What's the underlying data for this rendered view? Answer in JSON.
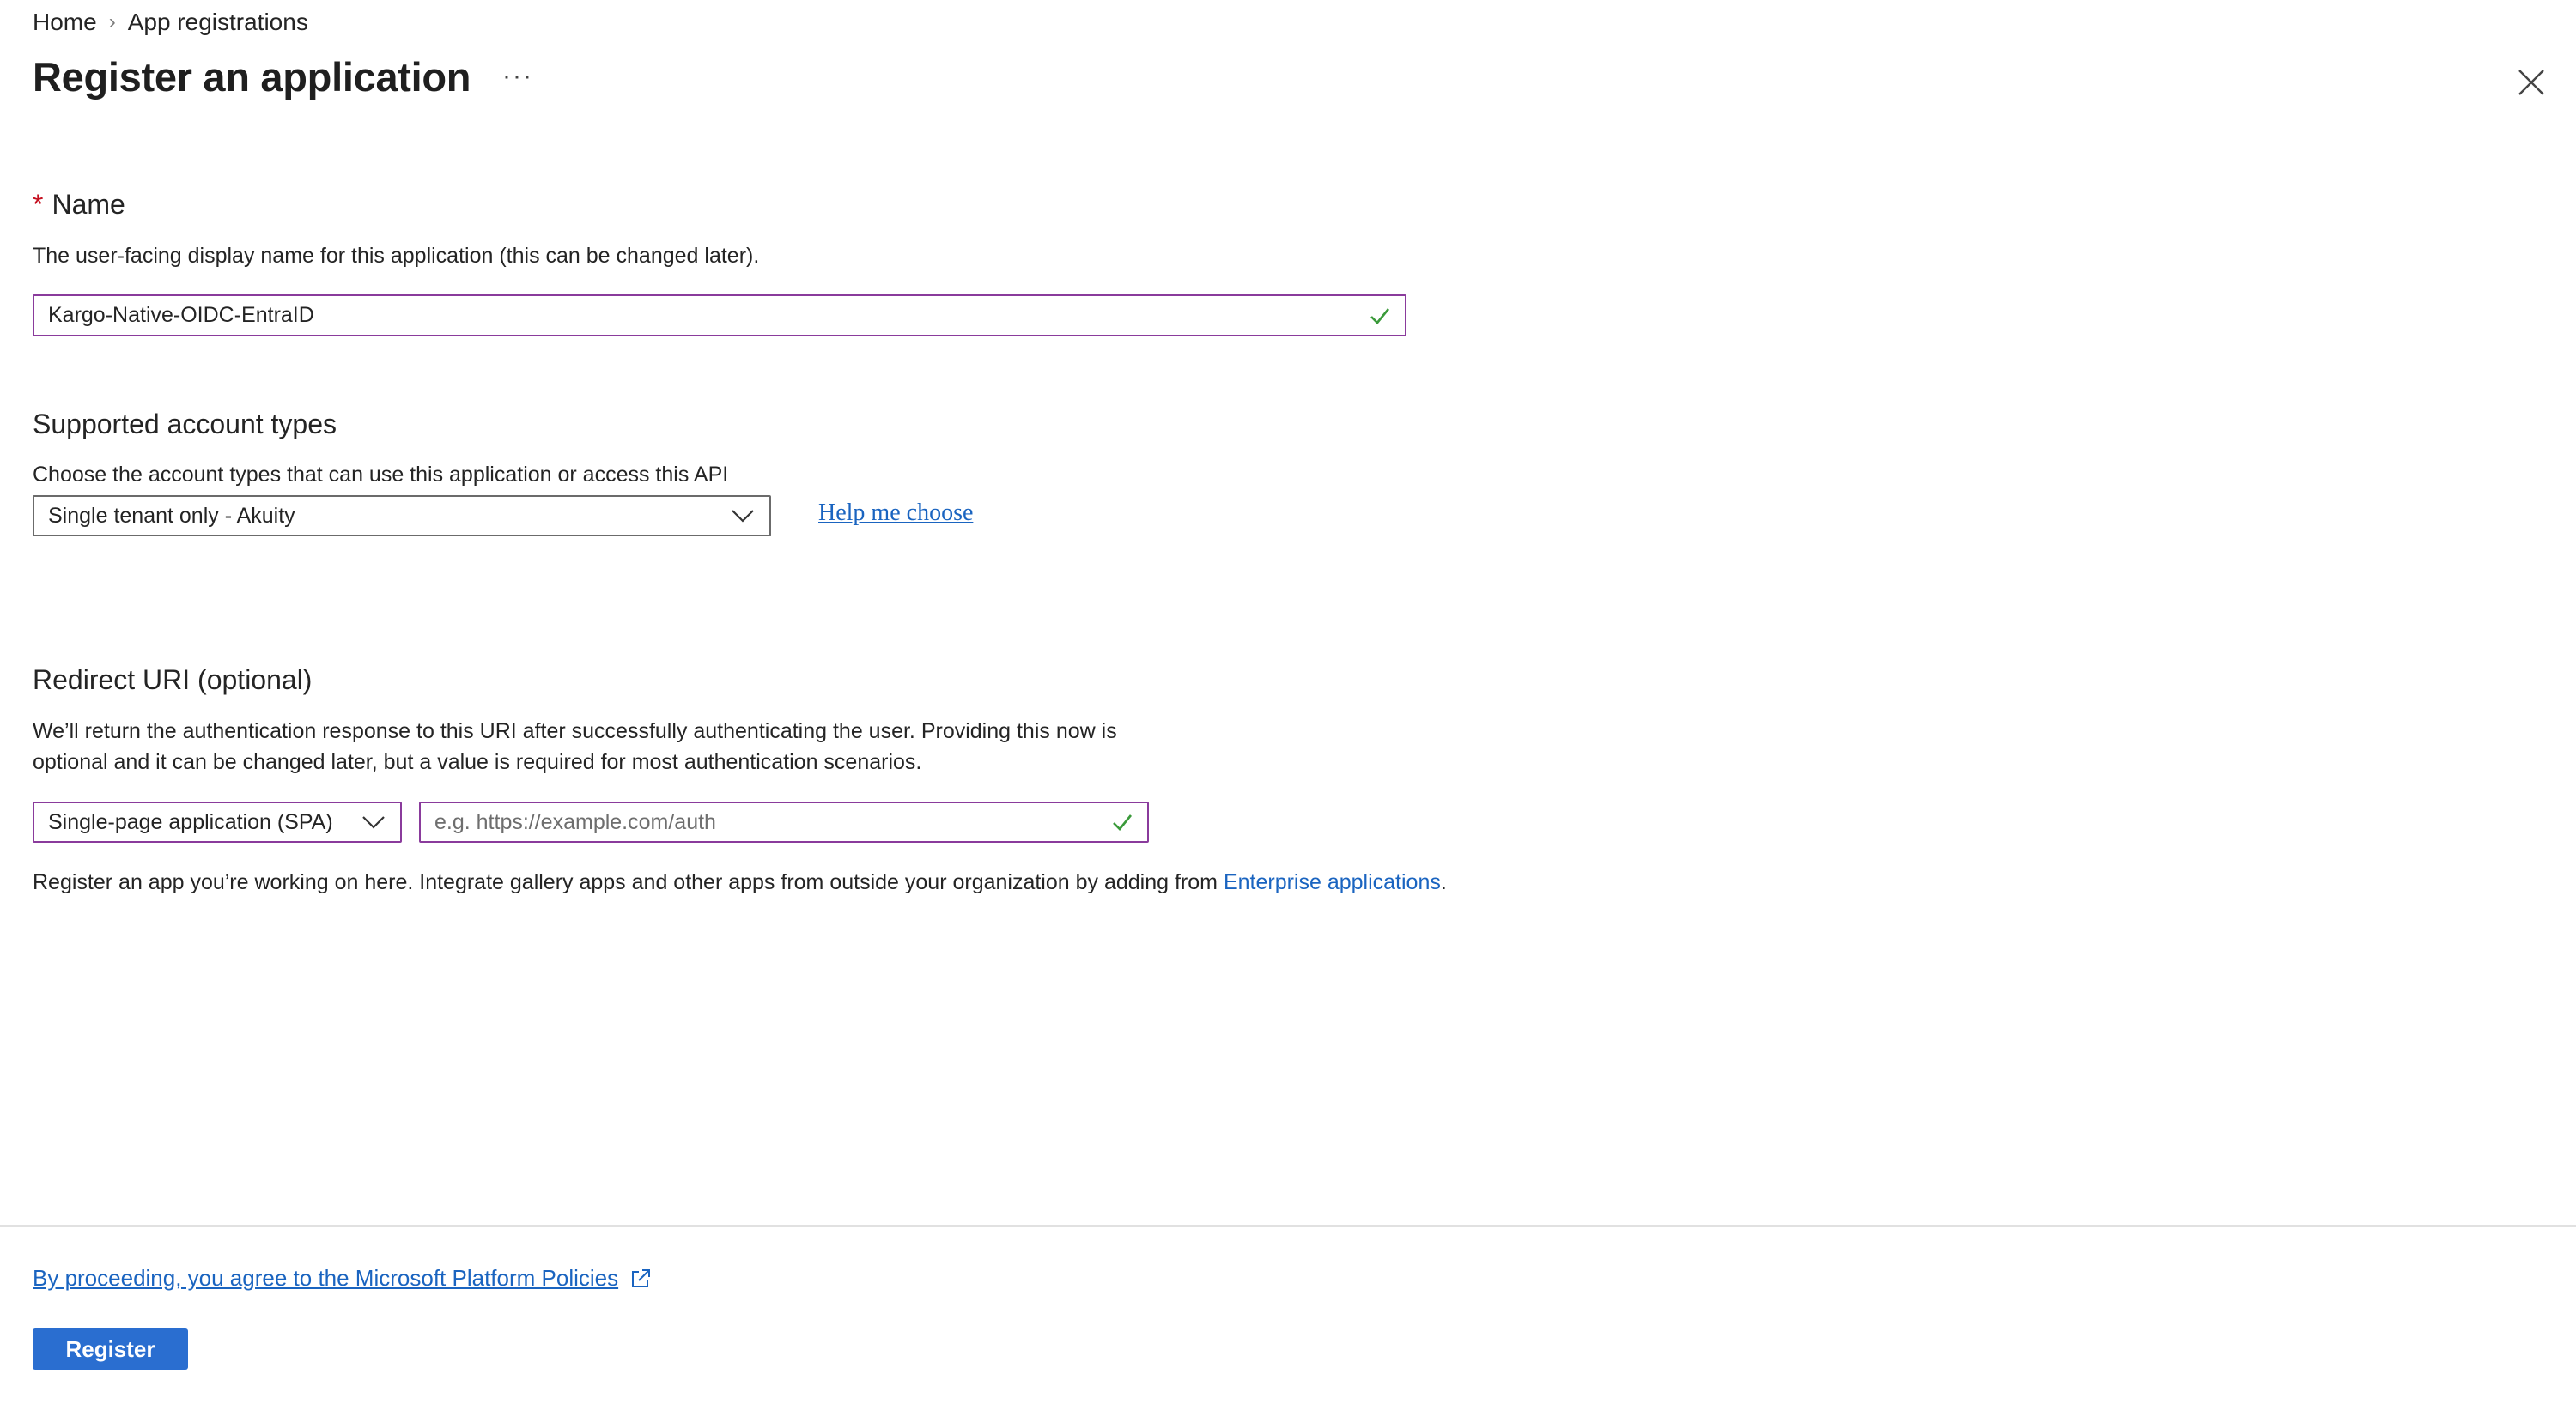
{
  "breadcrumb": {
    "home": "Home",
    "separator": "›",
    "current": "App registrations"
  },
  "title": "Register an application",
  "more_label": "···",
  "name_section": {
    "required_mark": "*",
    "heading": "Name",
    "description": "The user-facing display name for this application (this can be changed later).",
    "value": "Kargo-Native-OIDC-EntraID"
  },
  "account_section": {
    "heading": "Supported account types",
    "description": "Choose the account types that can use this application or access this API",
    "selected": "Single tenant only - Akuity",
    "help_link": "Help me choose"
  },
  "redirect_section": {
    "heading": "Redirect URI (optional)",
    "description_line1": "We’ll return the authentication response to this URI after successfully authenticating the user. Providing this now is",
    "description_line2": "optional and it can be changed later, but a value is required for most authentication scenarios.",
    "platform_selected": "Single-page application (SPA)",
    "uri_placeholder": "e.g. https://example.com/auth",
    "uri_value": ""
  },
  "note": {
    "text": "Register an app you’re working on here. Integrate gallery apps and other apps from outside your organization by adding from ",
    "link": "Enterprise applications",
    "suffix": "."
  },
  "footer": {
    "policy_link": "By proceeding, you agree to the Microsoft Platform Policies",
    "register_label": "Register"
  },
  "colors": {
    "accent": "#2a6ed0",
    "link": "#1a64c0",
    "focus_border": "#8a3b9c",
    "valid_check": "#3a9a3a",
    "required": "#c50f1f"
  },
  "icons": {
    "close": "close-icon",
    "check": "checkmark-icon",
    "chevron": "chevron-down-icon",
    "external": "external-link-icon"
  }
}
